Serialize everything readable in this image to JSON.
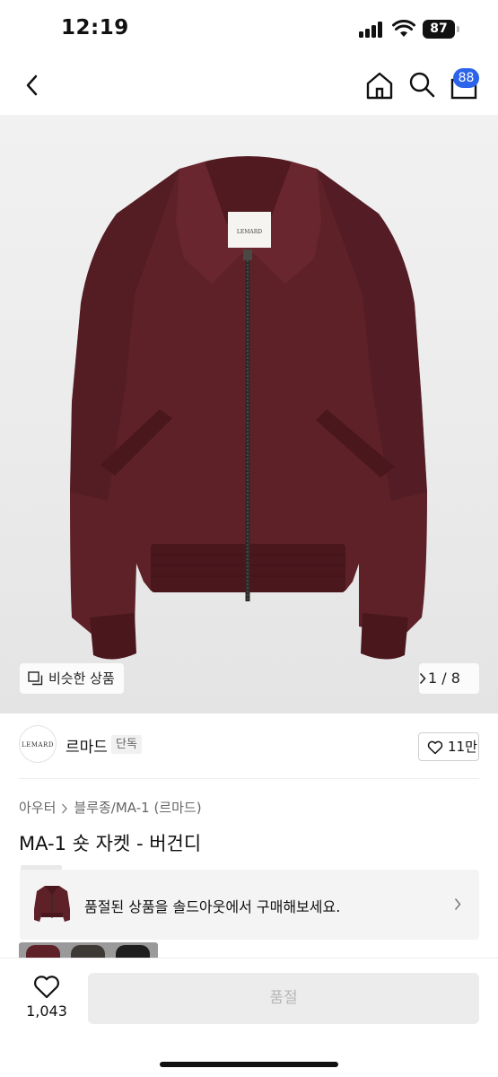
{
  "status_bar": {
    "time": "12:19",
    "battery": "87"
  },
  "nav": {
    "cart_count": "88"
  },
  "hero": {
    "similar_label": "비슷한 상품",
    "pager": "1 / 8",
    "jacket_color": "#5e2128",
    "jacket_label": "LEMARD"
  },
  "brand": {
    "logo_text": "LEMARD",
    "name": "르마드",
    "badge": "단독",
    "likes": "11만"
  },
  "breadcrumb": {
    "category": "아우터",
    "subcategory": "블루종/MA-1 (르마드)"
  },
  "product": {
    "title": "MA-1 숏 자켓 - 버건디"
  },
  "soldout_banner": {
    "text": "품절된 상품을 솔드아웃에서 구매해보세요."
  },
  "bottom_bar": {
    "wish_count": "1,043",
    "button_label": "품절"
  },
  "colors": {
    "accent_badge": "#2b64ea",
    "burgundy": "#5e2128"
  }
}
